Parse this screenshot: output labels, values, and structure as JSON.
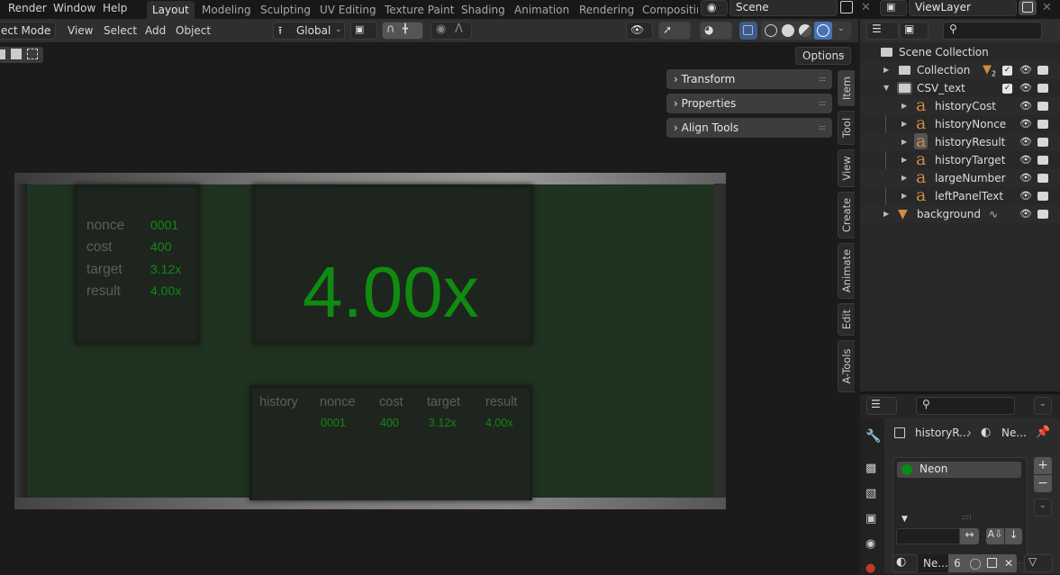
{
  "menu": {
    "items": [
      "Render",
      "Window",
      "Help"
    ]
  },
  "workspaces": {
    "tabs": [
      "Layout",
      "Modeling",
      "Sculpting",
      "UV Editing",
      "Texture Paint",
      "Shading",
      "Animation",
      "Rendering",
      "Compositin"
    ],
    "active": "Layout"
  },
  "scene": {
    "name": "Scene"
  },
  "view_layer": {
    "name": "ViewLayer"
  },
  "header": {
    "mode": "ect Mode",
    "menus": [
      "View",
      "Select",
      "Add",
      "Object"
    ],
    "orientation": "Global",
    "options_label": "Options"
  },
  "npanel": {
    "sections": [
      "Transform",
      "Properties",
      "Align Tools"
    ],
    "tabs": [
      "Item",
      "Tool",
      "View",
      "Create",
      "Animate",
      "Edit",
      "A-Tools"
    ],
    "active_tab": "Item"
  },
  "scene_content": {
    "left_panel": {
      "labels": [
        "nonce",
        "cost",
        "target",
        "result"
      ],
      "values": [
        "0001",
        "400",
        "3.12x",
        "4.00x"
      ]
    },
    "large_number": "4.00x",
    "history": {
      "title": "history",
      "headers": [
        "nonce",
        "cost",
        "target",
        "result"
      ],
      "rows": [
        [
          "0001",
          "400",
          "3.12x",
          "4.00x"
        ]
      ]
    },
    "colors": {
      "neon": "#108a10",
      "board": "#1f3320",
      "label": "#5c5e5c"
    }
  },
  "outliner": {
    "search_placeholder": "",
    "root": "Scene Collection",
    "items": [
      {
        "name": "Collection",
        "type": "collection",
        "badge": "2",
        "level": 1
      },
      {
        "name": "CSV_text",
        "type": "collection",
        "level": 1,
        "expanded": true
      },
      {
        "name": "historyCost",
        "type": "text",
        "level": 2
      },
      {
        "name": "historyNonce",
        "type": "text",
        "level": 2
      },
      {
        "name": "historyResult",
        "type": "text",
        "level": 2,
        "active": true
      },
      {
        "name": "historyTarget",
        "type": "text",
        "level": 2
      },
      {
        "name": "largeNumber",
        "type": "text",
        "level": 2
      },
      {
        "name": "leftPanelText",
        "type": "text",
        "level": 2
      },
      {
        "name": "background",
        "type": "mesh",
        "level": 1
      }
    ]
  },
  "properties": {
    "breadcrumb_object": "historyR...",
    "breadcrumb_material": "Ne...",
    "material_slot": "Neon",
    "material_color": "#0a8a1a",
    "material_name": "Ne...",
    "user_count": "6"
  }
}
